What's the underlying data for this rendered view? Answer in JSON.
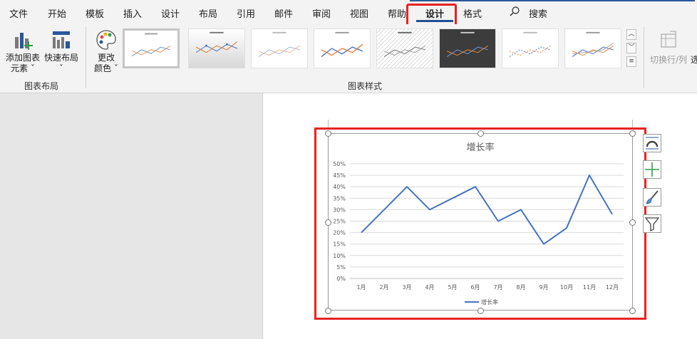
{
  "ribbon": {
    "tabs": [
      "文件",
      "开始",
      "模板",
      "插入",
      "设计",
      "布局",
      "引用",
      "邮件",
      "审阅",
      "视图",
      "帮助",
      "设计",
      "格式"
    ],
    "active_tab_index": 11,
    "search_label": "搜索",
    "groups": {
      "chart_layout": {
        "label": "图表布局",
        "add_element": [
          "添加图表",
          "元素"
        ],
        "quick_layout": "快速布局"
      },
      "chart_styles": {
        "label": "图表样式",
        "change_colors": [
          "更改",
          "颜色"
        ]
      },
      "data": {
        "switch_row_col": "切换行/列",
        "partial_next": "选"
      }
    }
  },
  "chart_data": {
    "type": "line",
    "title": "增长率",
    "categories": [
      "1月",
      "2月",
      "3月",
      "4月",
      "5月",
      "6月",
      "7月",
      "8月",
      "9月",
      "10月",
      "11月",
      "12月"
    ],
    "series": [
      {
        "name": "增长率",
        "values": [
          0.2,
          0.3,
          0.4,
          0.3,
          0.35,
          0.4,
          0.25,
          0.3,
          0.15,
          0.22,
          0.45,
          0.28
        ],
        "color": "#4472c4"
      }
    ],
    "yticks": [
      "0%",
      "5%",
      "10%",
      "15%",
      "20%",
      "25%",
      "30%",
      "35%",
      "40%",
      "45%",
      "50%"
    ],
    "ylim": [
      0,
      0.5
    ],
    "grid": true,
    "legend": "bottom"
  },
  "colors": {
    "accent": "#2b579a",
    "selection": "#e52420",
    "series": "#4472c4"
  }
}
